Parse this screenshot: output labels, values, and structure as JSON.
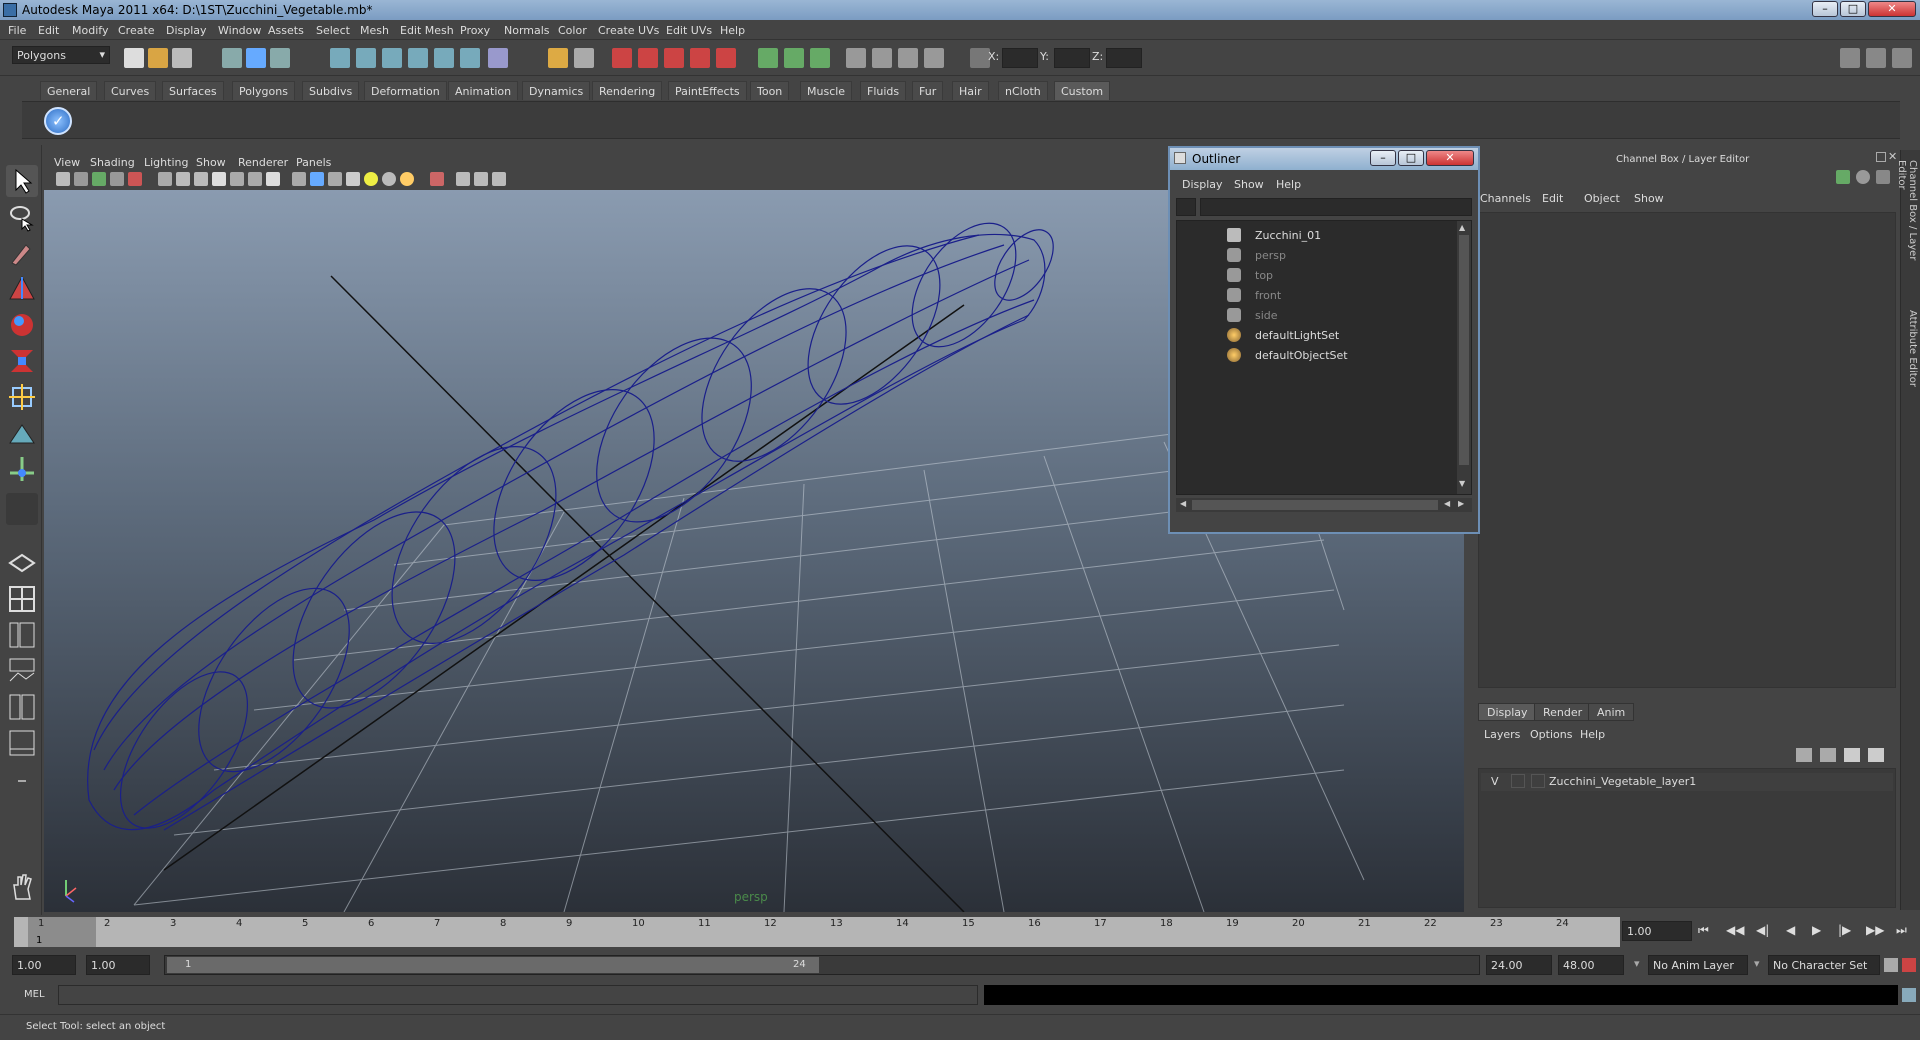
{
  "window": {
    "title": "Autodesk Maya 2011 x64: D:\\1ST\\Zucchini_Vegetable.mb*"
  },
  "menubar": [
    "File",
    "Edit",
    "Modify",
    "Create",
    "Display",
    "Window",
    "Assets",
    "Select",
    "Mesh",
    "Edit Mesh",
    "Proxy",
    "Normals",
    "Color",
    "Create UVs",
    "Edit UVs",
    "Help"
  ],
  "toolbar": {
    "mode": "Polygons",
    "x_label": "X:",
    "y_label": "Y:",
    "z_label": "Z:"
  },
  "shelf_tabs": [
    "General",
    "Curves",
    "Surfaces",
    "Polygons",
    "Subdivs",
    "Deformation",
    "Animation",
    "Dynamics",
    "Rendering",
    "PaintEffects",
    "Toon",
    "Muscle",
    "Fluids",
    "Fur",
    "Hair",
    "nCloth",
    "Custom"
  ],
  "active_shelf": "Custom",
  "viewport": {
    "menu": [
      "View",
      "Shading",
      "Lighting",
      "Show",
      "Renderer",
      "Panels"
    ],
    "camera_label": "persp"
  },
  "outliner": {
    "title": "Outliner",
    "menu": [
      "Display",
      "Show",
      "Help"
    ],
    "items": [
      {
        "label": "Zucchini_01",
        "dim": false,
        "icon": "mesh-icon"
      },
      {
        "label": "persp",
        "dim": true,
        "icon": "camera-icon"
      },
      {
        "label": "top",
        "dim": true,
        "icon": "camera-icon"
      },
      {
        "label": "front",
        "dim": true,
        "icon": "camera-icon"
      },
      {
        "label": "side",
        "dim": true,
        "icon": "camera-icon"
      },
      {
        "label": "defaultLightSet",
        "dim": false,
        "icon": "set-icon"
      },
      {
        "label": "defaultObjectSet",
        "dim": false,
        "icon": "set-icon"
      }
    ]
  },
  "channel_box": {
    "title": "Channel Box / Layer Editor",
    "menu": [
      "Channels",
      "Edit",
      "Object",
      "Show"
    ]
  },
  "side_tabs": [
    "Channel Box / Layer Editor",
    "Attribute Editor"
  ],
  "layer_editor": {
    "tabs": [
      "Display",
      "Render",
      "Anim"
    ],
    "menu": [
      "Layers",
      "Options",
      "Help"
    ],
    "layer": {
      "visible": "V",
      "name": "Zucchini_Vegetable_layer1"
    }
  },
  "timeline": {
    "ticks": [
      "1",
      "2",
      "3",
      "4",
      "5",
      "6",
      "7",
      "8",
      "9",
      "10",
      "11",
      "12",
      "13",
      "14",
      "15",
      "16",
      "17",
      "18",
      "19",
      "20",
      "21",
      "22",
      "23",
      "24"
    ],
    "current_frame_marker": "1",
    "current_time": "1.00"
  },
  "range": {
    "start": "1.00",
    "playback_start": "1.00",
    "slider_start": "1",
    "slider_end": "24",
    "playback_end": "24.00",
    "end": "48.00",
    "anim_layer": "No Anim Layer",
    "character_set": "No Character Set"
  },
  "command_line": {
    "label": "MEL"
  },
  "help_line": "Select Tool: select an object",
  "colors": {
    "wire": "#1a1f8a",
    "panel": "#444444",
    "dark_field": "#2b2b2b",
    "title_blue": "#8fb0cf"
  }
}
